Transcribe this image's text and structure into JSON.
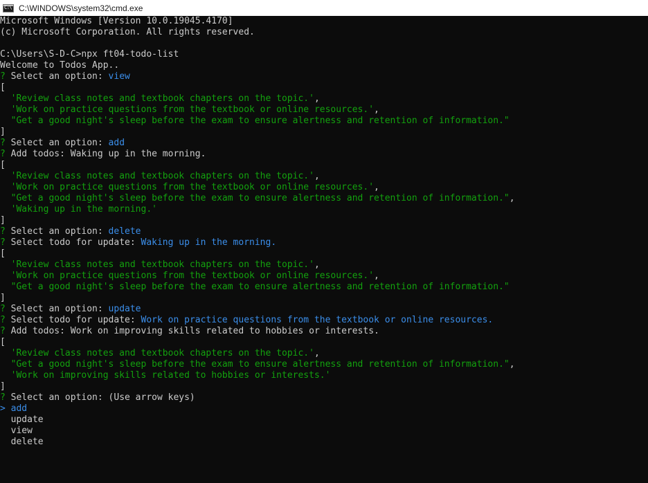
{
  "window": {
    "title": "C:\\WINDOWS\\system32\\cmd.exe",
    "icon": "cmd-icon",
    "icon_text": "C:\\"
  },
  "colors": {
    "background": "#0c0c0c",
    "text": "#cccccc",
    "green": "#13a10e",
    "blue": "#3b8eea"
  },
  "lines": [
    {
      "segments": [
        {
          "text": "Microsoft Windows [Version 10.0.19045.4170]",
          "color": "w"
        }
      ]
    },
    {
      "segments": [
        {
          "text": "(c) Microsoft Corporation. All rights reserved.",
          "color": "w"
        }
      ]
    },
    {
      "segments": [
        {
          "text": "",
          "color": "w"
        }
      ]
    },
    {
      "segments": [
        {
          "text": "C:\\Users\\S-D-C>npx ft04-todo-list",
          "color": "w"
        }
      ]
    },
    {
      "segments": [
        {
          "text": "Welcome to Todos App..",
          "color": "w"
        }
      ]
    },
    {
      "segments": [
        {
          "text": "? ",
          "color": "g"
        },
        {
          "text": "Select an option: ",
          "color": "w"
        },
        {
          "text": "view",
          "color": "b"
        }
      ]
    },
    {
      "segments": [
        {
          "text": "[",
          "color": "w"
        }
      ]
    },
    {
      "segments": [
        {
          "text": "  'Review class notes and textbook chapters on the topic.'",
          "color": "g"
        },
        {
          "text": ",",
          "color": "w"
        }
      ]
    },
    {
      "segments": [
        {
          "text": "  'Work on practice questions from the textbook or online resources.'",
          "color": "g"
        },
        {
          "text": ",",
          "color": "w"
        }
      ]
    },
    {
      "segments": [
        {
          "text": "  \"Get a good night's sleep before the exam to ensure alertness and retention of information.\"",
          "color": "g"
        }
      ]
    },
    {
      "segments": [
        {
          "text": "]",
          "color": "w"
        }
      ]
    },
    {
      "segments": [
        {
          "text": "? ",
          "color": "g"
        },
        {
          "text": "Select an option: ",
          "color": "w"
        },
        {
          "text": "add",
          "color": "b"
        }
      ]
    },
    {
      "segments": [
        {
          "text": "? ",
          "color": "g"
        },
        {
          "text": "Add todos: Waking up in the morning.",
          "color": "w"
        }
      ]
    },
    {
      "segments": [
        {
          "text": "[",
          "color": "w"
        }
      ]
    },
    {
      "segments": [
        {
          "text": "  'Review class notes and textbook chapters on the topic.'",
          "color": "g"
        },
        {
          "text": ",",
          "color": "w"
        }
      ]
    },
    {
      "segments": [
        {
          "text": "  'Work on practice questions from the textbook or online resources.'",
          "color": "g"
        },
        {
          "text": ",",
          "color": "w"
        }
      ]
    },
    {
      "segments": [
        {
          "text": "  \"Get a good night's sleep before the exam to ensure alertness and retention of information.\"",
          "color": "g"
        },
        {
          "text": ",",
          "color": "w"
        }
      ]
    },
    {
      "segments": [
        {
          "text": "  'Waking up in the morning.'",
          "color": "g"
        }
      ]
    },
    {
      "segments": [
        {
          "text": "]",
          "color": "w"
        }
      ]
    },
    {
      "segments": [
        {
          "text": "? ",
          "color": "g"
        },
        {
          "text": "Select an option: ",
          "color": "w"
        },
        {
          "text": "delete",
          "color": "b"
        }
      ]
    },
    {
      "segments": [
        {
          "text": "? ",
          "color": "g"
        },
        {
          "text": "Select todo for update: ",
          "color": "w"
        },
        {
          "text": "Waking up in the morning.",
          "color": "b"
        }
      ]
    },
    {
      "segments": [
        {
          "text": "[",
          "color": "w"
        }
      ]
    },
    {
      "segments": [
        {
          "text": "  'Review class notes and textbook chapters on the topic.'",
          "color": "g"
        },
        {
          "text": ",",
          "color": "w"
        }
      ]
    },
    {
      "segments": [
        {
          "text": "  'Work on practice questions from the textbook or online resources.'",
          "color": "g"
        },
        {
          "text": ",",
          "color": "w"
        }
      ]
    },
    {
      "segments": [
        {
          "text": "  \"Get a good night's sleep before the exam to ensure alertness and retention of information.\"",
          "color": "g"
        }
      ]
    },
    {
      "segments": [
        {
          "text": "]",
          "color": "w"
        }
      ]
    },
    {
      "segments": [
        {
          "text": "? ",
          "color": "g"
        },
        {
          "text": "Select an option: ",
          "color": "w"
        },
        {
          "text": "update",
          "color": "b"
        }
      ]
    },
    {
      "segments": [
        {
          "text": "? ",
          "color": "g"
        },
        {
          "text": "Select todo for update: ",
          "color": "w"
        },
        {
          "text": "Work on practice questions from the textbook or online resources.",
          "color": "b"
        }
      ]
    },
    {
      "segments": [
        {
          "text": "? ",
          "color": "g"
        },
        {
          "text": "Add todos: Work on improving skills related to hobbies or interests.",
          "color": "w"
        }
      ]
    },
    {
      "segments": [
        {
          "text": "[",
          "color": "w"
        }
      ]
    },
    {
      "segments": [
        {
          "text": "  'Review class notes and textbook chapters on the topic.'",
          "color": "g"
        },
        {
          "text": ",",
          "color": "w"
        }
      ]
    },
    {
      "segments": [
        {
          "text": "  \"Get a good night's sleep before the exam to ensure alertness and retention of information.\"",
          "color": "g"
        },
        {
          "text": ",",
          "color": "w"
        }
      ]
    },
    {
      "segments": [
        {
          "text": "  'Work on improving skills related to hobbies or interests.'",
          "color": "g"
        }
      ]
    },
    {
      "segments": [
        {
          "text": "]",
          "color": "w"
        }
      ]
    },
    {
      "segments": [
        {
          "text": "? ",
          "color": "g"
        },
        {
          "text": "Select an option: (Use arrow keys)",
          "color": "w"
        }
      ]
    },
    {
      "segments": [
        {
          "text": "> add",
          "color": "b"
        }
      ]
    },
    {
      "segments": [
        {
          "text": "  update",
          "color": "w"
        }
      ]
    },
    {
      "segments": [
        {
          "text": "  view",
          "color": "w"
        }
      ]
    },
    {
      "segments": [
        {
          "text": "  delete",
          "color": "w"
        }
      ]
    }
  ]
}
